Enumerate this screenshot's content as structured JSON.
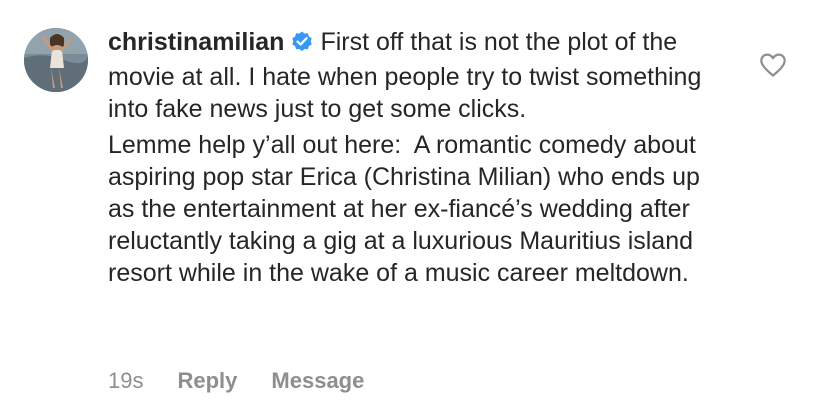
{
  "comment": {
    "username": "christinamilian",
    "verified": true,
    "text_first": "First off that is not the plot of the movie at all. I hate when people try to twist something into fake news just to get some clicks.",
    "text_second": "Lemme help y’all out here:  A romantic comedy about aspiring pop star Erica (Christina Milian) who ends up as the entertainment at her ex-fiancé’s wedding after reluctantly taking a gig at a luxurious Mauritius island resort while in the wake of a music career meltdown.",
    "timestamp": "19s",
    "reply_label": "Reply",
    "message_label": "Message"
  },
  "icons": {
    "verified": "verified-badge-icon",
    "like": "heart-icon"
  },
  "colors": {
    "text": "#262626",
    "muted": "#8e8e8e",
    "verified_blue": "#3897f0"
  }
}
